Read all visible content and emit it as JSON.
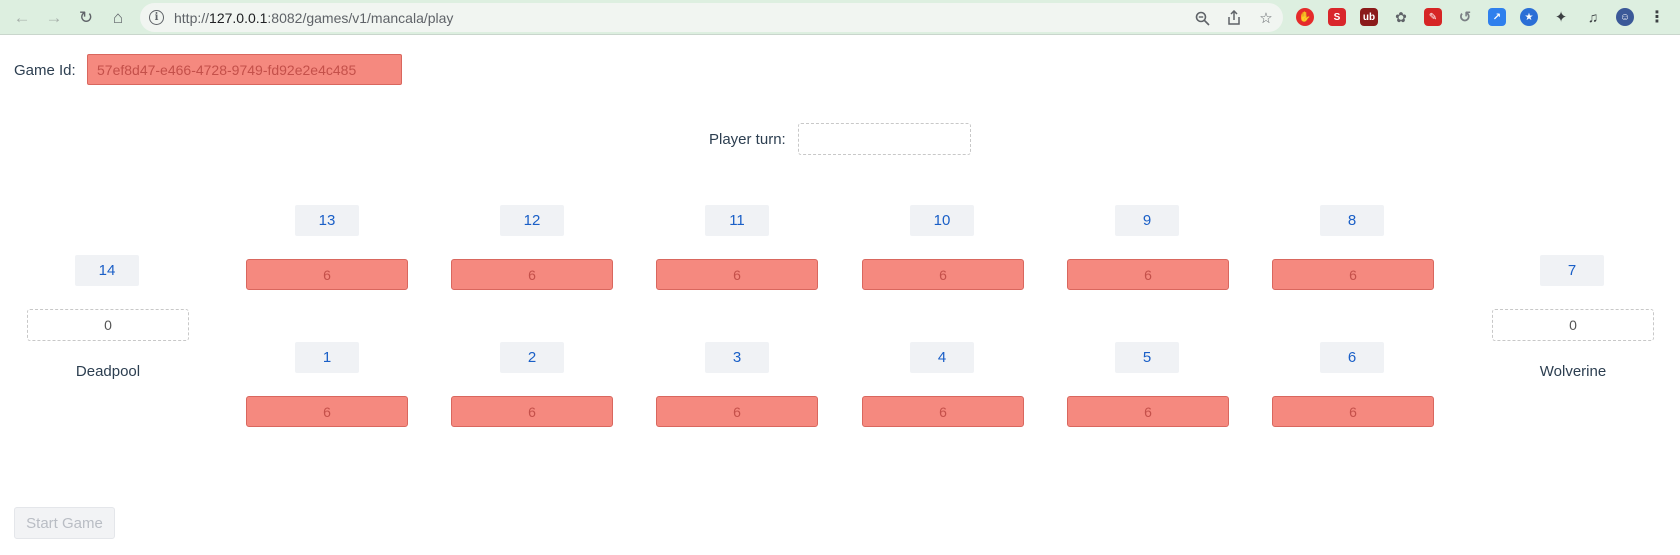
{
  "browser": {
    "url_prefix": "http://",
    "url_host": "127.0.0.1",
    "url_rest": ":8082/games/v1/mancala/play",
    "accent": "#ddefe0"
  },
  "game": {
    "id_label": "Game Id:",
    "id_value": "57ef8d47-e466-4728-9749-fd92e2e4c485",
    "turn_label": "Player turn:",
    "turn_value": ""
  },
  "board": {
    "top_pits": [
      {
        "label": "13",
        "value": "6"
      },
      {
        "label": "12",
        "value": "6"
      },
      {
        "label": "11",
        "value": "6"
      },
      {
        "label": "10",
        "value": "6"
      },
      {
        "label": "9",
        "value": "6"
      },
      {
        "label": "8",
        "value": "6"
      }
    ],
    "bottom_pits": [
      {
        "label": "1",
        "value": "6"
      },
      {
        "label": "2",
        "value": "6"
      },
      {
        "label": "3",
        "value": "6"
      },
      {
        "label": "4",
        "value": "6"
      },
      {
        "label": "5",
        "value": "6"
      },
      {
        "label": "6",
        "value": "6"
      }
    ],
    "left_store": {
      "label": "14",
      "value": "0",
      "player": "Deadpool"
    },
    "right_store": {
      "label": "7",
      "value": "0",
      "player": "Wolverine"
    }
  },
  "actions": {
    "start_label": "Start Game"
  },
  "colors": {
    "pit_fill": "#f5897f",
    "pit_text": "#c4504a",
    "label_text": "#1a5fc7"
  }
}
